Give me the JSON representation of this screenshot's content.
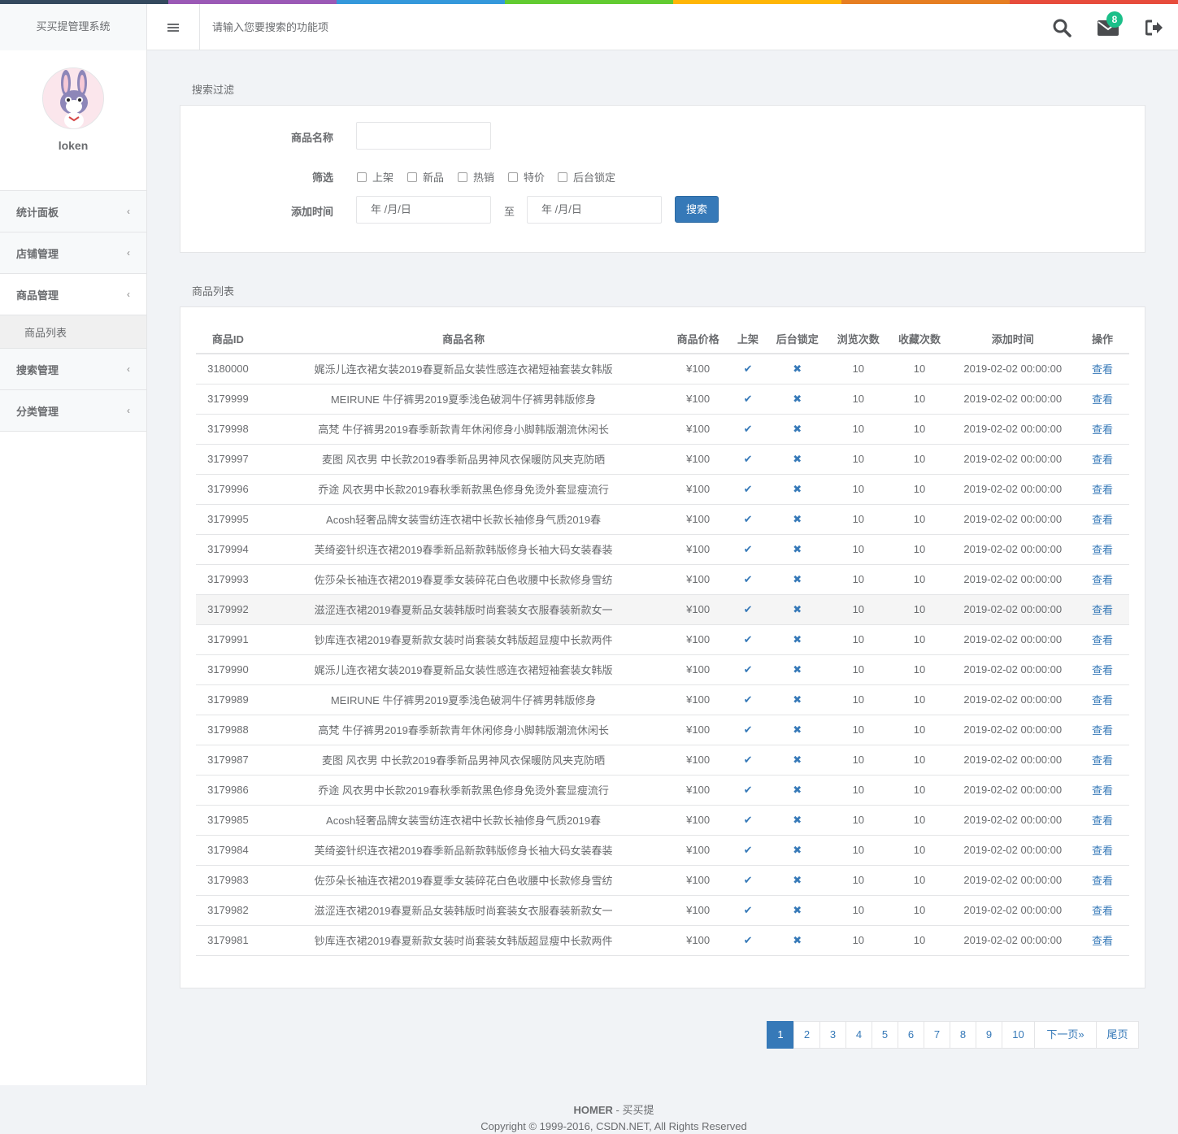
{
  "colors": {
    "accent": "#3679b8",
    "badge": "#1bbf89",
    "colorbar": [
      "#34495e",
      "#9b59b6",
      "#3498db",
      "#62cb31",
      "#ffb606",
      "#e67e22",
      "#e74c3c"
    ]
  },
  "header": {
    "app_title": "买买提管理系统",
    "search_placeholder": "请输入您要搜索的功能项",
    "mail_badge": "8"
  },
  "sidebar": {
    "username": "loken",
    "items": [
      {
        "label": "统计面板"
      },
      {
        "label": "店铺管理"
      },
      {
        "label": "商品管理"
      },
      {
        "label": "商品列表"
      },
      {
        "label": "搜索管理"
      },
      {
        "label": "分类管理"
      }
    ]
  },
  "filter": {
    "section_title": "搜索过滤",
    "name_label": "商品名称",
    "name_value": "",
    "filter_label": "筛选",
    "checkboxes": [
      "上架",
      "新品",
      "热销",
      "特价",
      "后台锁定"
    ],
    "date_label": "添加时间",
    "date_from": "年 /月/日",
    "date_sep": "至",
    "date_to": "年 /月/日",
    "search_button": "搜索"
  },
  "list": {
    "section_title": "商品列表",
    "columns": [
      "商品ID",
      "商品名称",
      "商品价格",
      "上架",
      "后台锁定",
      "浏览次数",
      "收藏次数",
      "添加时间",
      "操作"
    ],
    "rows": [
      [
        "3180000",
        "娓泺儿连衣裙女装2019春夏新品女装性感连衣裙短袖套装女韩版",
        "¥100",
        "10",
        "10",
        "2019-02-02 00:00:00",
        "查看"
      ],
      [
        "3179999",
        "MEIRUNE 牛仔裤男2019夏季浅色破洞牛仔裤男韩版修身",
        "¥100",
        "10",
        "10",
        "2019-02-02 00:00:00",
        "查看"
      ],
      [
        "3179998",
        "高梵 牛仔裤男2019春季新款青年休闲修身小脚韩版潮流休闲长",
        "¥100",
        "10",
        "10",
        "2019-02-02 00:00:00",
        "查看"
      ],
      [
        "3179997",
        "麦图 风衣男 中长款2019春季新品男神风衣保暖防风夹克防晒",
        "¥100",
        "10",
        "10",
        "2019-02-02 00:00:00",
        "查看"
      ],
      [
        "3179996",
        "乔途 风衣男中长款2019春秋季新款黑色修身免烫外套显瘦流行",
        "¥100",
        "10",
        "10",
        "2019-02-02 00:00:00",
        "查看"
      ],
      [
        "3179995",
        "Acosh轻奢品牌女装雪纺连衣裙中长款长袖修身气质2019春",
        "¥100",
        "10",
        "10",
        "2019-02-02 00:00:00",
        "查看"
      ],
      [
        "3179994",
        "芙绮姿针织连衣裙2019春季新品新款韩版修身长袖大码女装春装",
        "¥100",
        "10",
        "10",
        "2019-02-02 00:00:00",
        "查看"
      ],
      [
        "3179993",
        "佐莎朵长袖连衣裙2019春夏季女装碎花白色收腰中长款修身雪纺",
        "¥100",
        "10",
        "10",
        "2019-02-02 00:00:00",
        "查看"
      ],
      [
        "3179992",
        "滋涩连衣裙2019春夏新品女装韩版时尚套装女衣服春装新款女一",
        "¥100",
        "10",
        "10",
        "2019-02-02 00:00:00",
        "查看"
      ],
      [
        "3179991",
        "钞库连衣裙2019春夏新款女装时尚套装女韩版超显瘦中长款两件",
        "¥100",
        "10",
        "10",
        "2019-02-02 00:00:00",
        "查看"
      ],
      [
        "3179990",
        "娓泺儿连衣裙女装2019春夏新品女装性感连衣裙短袖套装女韩版",
        "¥100",
        "10",
        "10",
        "2019-02-02 00:00:00",
        "查看"
      ],
      [
        "3179989",
        "MEIRUNE 牛仔裤男2019夏季浅色破洞牛仔裤男韩版修身",
        "¥100",
        "10",
        "10",
        "2019-02-02 00:00:00",
        "查看"
      ],
      [
        "3179988",
        "高梵 牛仔裤男2019春季新款青年休闲修身小脚韩版潮流休闲长",
        "¥100",
        "10",
        "10",
        "2019-02-02 00:00:00",
        "查看"
      ],
      [
        "3179987",
        "麦图 风衣男 中长款2019春季新品男神风衣保暖防风夹克防晒",
        "¥100",
        "10",
        "10",
        "2019-02-02 00:00:00",
        "查看"
      ],
      [
        "3179986",
        "乔途 风衣男中长款2019春秋季新款黑色修身免烫外套显瘦流行",
        "¥100",
        "10",
        "10",
        "2019-02-02 00:00:00",
        "查看"
      ],
      [
        "3179985",
        "Acosh轻奢品牌女装雪纺连衣裙中长款长袖修身气质2019春",
        "¥100",
        "10",
        "10",
        "2019-02-02 00:00:00",
        "查看"
      ],
      [
        "3179984",
        "芙绮姿针织连衣裙2019春季新品新款韩版修身长袖大码女装春装",
        "¥100",
        "10",
        "10",
        "2019-02-02 00:00:00",
        "查看"
      ],
      [
        "3179983",
        "佐莎朵长袖连衣裙2019春夏季女装碎花白色收腰中长款修身雪纺",
        "¥100",
        "10",
        "10",
        "2019-02-02 00:00:00",
        "查看"
      ],
      [
        "3179982",
        "滋涩连衣裙2019春夏新品女装韩版时尚套装女衣服春装新款女一",
        "¥100",
        "10",
        "10",
        "2019-02-02 00:00:00",
        "查看"
      ],
      [
        "3179981",
        "钞库连衣裙2019春夏新款女装时尚套装女韩版超显瘦中长款两件",
        "¥100",
        "10",
        "10",
        "2019-02-02 00:00:00",
        "查看"
      ]
    ],
    "highlighted_row": 8
  },
  "pagination": {
    "pages": [
      "1",
      "2",
      "3",
      "4",
      "5",
      "6",
      "7",
      "8",
      "9",
      "10",
      "下一页»",
      "尾页"
    ],
    "current": "1"
  },
  "footer": {
    "brand": "HOMER",
    "brand_suffix": " - 买买提",
    "copyright": "Copyright © 1999-2016, CSDN.NET, All Rights Reserved"
  }
}
